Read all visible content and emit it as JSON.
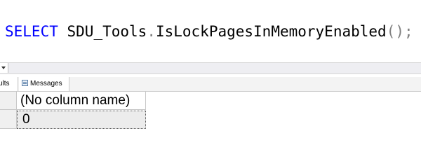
{
  "editor": {
    "keyword": "SELECT",
    "schema": "SDU_Tools",
    "dot": ".",
    "function_name": "IsLockPagesInMemoryEnabled",
    "call_parens": "()",
    "terminator": ";"
  },
  "tabs": [
    {
      "label": "sults",
      "icon": "grid-icon"
    },
    {
      "label": "Messages",
      "icon": "messages-icon"
    }
  ],
  "results": {
    "columns": [
      "(No column name)"
    ],
    "rows": [
      [
        "0"
      ]
    ]
  },
  "colors": {
    "keyword": "#0000ff",
    "punctuation": "#808080",
    "selected_cell": "#ececec"
  }
}
